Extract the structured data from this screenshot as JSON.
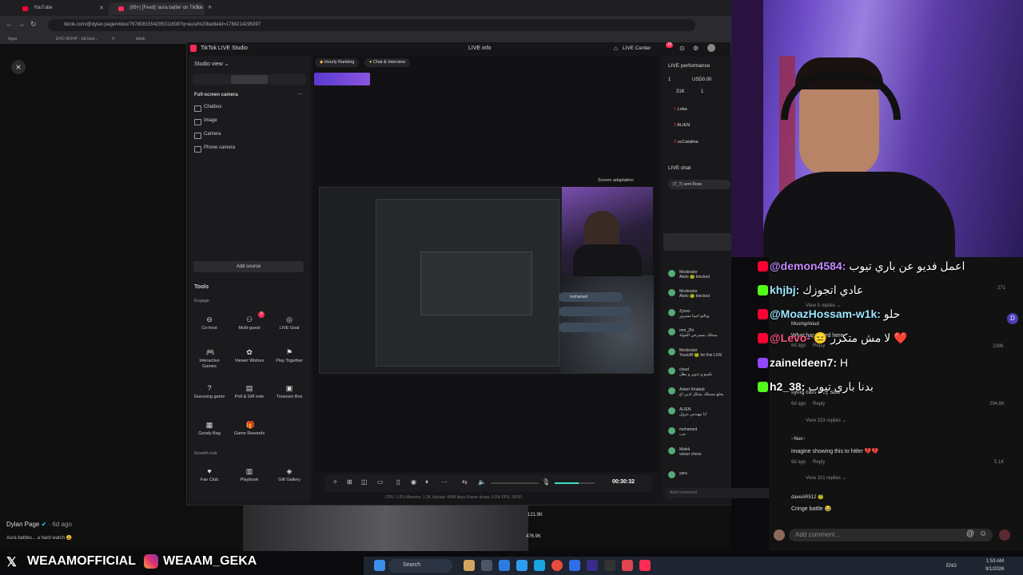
{
  "browser": {
    "tabs": [
      {
        "title": "YouTube",
        "color": "#ff0033"
      },
      {
        "title": "(99+) [Feed] 'aura battle' on TikTok",
        "color": "#fe2c55"
      }
    ],
    "new_tab": "+",
    "url": "tiktok.com/@dylan.page/video/7678081554295311638?q=aura%20battle&t=1788214295397",
    "bookmarks": [
      "Apps",
      "EHC-MOHP - EESeid...",
      "X",
      "tiktok"
    ]
  },
  "close_label": "×",
  "studio": {
    "title": "TikTok LIVE Studio",
    "live_info": "LIVE info",
    "live_center": "LIVE Center",
    "badge_count": "10",
    "studio_view": "Studio view ⌄",
    "fullscreen_camera": "Full-screen camera",
    "sources": [
      "Chatbox",
      "Image",
      "Camera",
      "Phone camera"
    ],
    "add_source": "Add source",
    "tools_title": "Tools",
    "engage": "Engage",
    "tools": [
      {
        "label": "Co-host",
        "icon": "⊖"
      },
      {
        "label": "Multi-guest",
        "icon": "⚇",
        "badge": "3"
      },
      {
        "label": "LIVE Goal",
        "icon": "◎"
      },
      {
        "label": "Interactive Games",
        "icon": "🎮"
      },
      {
        "label": "Viewer Wishes",
        "icon": "✿"
      },
      {
        "label": "Play Together",
        "icon": "⚑"
      },
      {
        "label": "Guessing game",
        "icon": "?"
      },
      {
        "label": "Poll & Gift vote",
        "icon": "▤"
      },
      {
        "label": "Treasure Box",
        "icon": "▣"
      },
      {
        "label": "Goody Bag",
        "icon": "▦"
      },
      {
        "label": "Game Rewards",
        "icon": "🎁"
      }
    ],
    "growth_hub": "Growth hub",
    "growth_tools": [
      {
        "label": "Fan Club",
        "icon": "♥"
      },
      {
        "label": "Playbook",
        "icon": "▥"
      },
      {
        "label": "Gift Gallery",
        "icon": "◈"
      }
    ],
    "pills": [
      "Hourly Ranking",
      "Chat & Interview"
    ],
    "screen_adaptation": "Screen adaptation",
    "timer": "00:30:32",
    "stats": "CPU: 1.6%   Memory: 1.2K   Upload: 4584 kbps   Frame drops: 0.0%   FPS: 30/30",
    "live_performance": "LIVE performance",
    "perf_values": {
      "viewers": "1",
      "usd": "USD0.00",
      "likes": "31K",
      "shares": "1"
    },
    "ranking": [
      "Loka",
      "ALIEN",
      "ucCatalina"
    ],
    "live_chat": "LIVE chat",
    "sent_rose": "(T_T) sent Rose",
    "chat": [
      {
        "user": "cloud",
        "text": "نكسو و تدوير و بطل"
      },
      {
        "user": "Moderator",
        "text": "Abdo 🐸 blocked"
      },
      {
        "user": "Moderator",
        "text": "Abdo 🐸 blocked"
      },
      {
        "user": "Zynex",
        "text": "وبالتو اجينا مسرور"
      },
      {
        "user": "mm_Zhi",
        "text": "ممثلك بمسرحي الجولة"
      },
      {
        "user": "Moderator",
        "text": "YoutuBf 🐸 for this LIVE"
      },
      {
        "user": "cloud",
        "text": "نكسو و تدوير و بطل"
      },
      {
        "user": "Adam Khattab",
        "text": "يخلع مستلك بشكل لدين اخ"
      },
      {
        "user": "ALIEN",
        "text": "انا مهندس بترول"
      },
      {
        "user": "mohamed",
        "text": "حب"
      },
      {
        "user": "Malek",
        "text": "voiser chera"
      },
      {
        "user": "yara",
        "text": "joined"
      }
    ],
    "add_comment": "Add comment"
  },
  "overlay_chat": [
    {
      "platform": "youtube",
      "name": "@demon4584:",
      "text": "اعمل فديو عن باري تيوب",
      "color": "#c48cff"
    },
    {
      "platform": "kick",
      "name": "khjbj:",
      "text": "عادي اتجوزك",
      "color": "#53fc18"
    },
    {
      "platform": "youtube",
      "name": "@MoazHossam-w1k:",
      "text": "حلو",
      "color": "#9fe8ff"
    },
    {
      "platform": "youtube",
      "name": "@Levo-",
      "text": "😑 لا مش متكرر ❤️",
      "color": "#ff5b8a"
    },
    {
      "platform": "twitch",
      "name": "zaineldeen7:",
      "text": "H",
      "color": "#ffffff"
    },
    {
      "platform": "kick",
      "name": "h2_38:",
      "text": "بدنا باري تيوب",
      "color": "#ffffff"
    }
  ],
  "tiktok_side": {
    "view_replies_5": "View 5 replies ⌄",
    "musing": "MusingAloud",
    "what_happ": "What happened here",
    "reply": "Reply",
    "flying": "flying cars they said",
    "view_153": "View 153 replies ⌄",
    "nux": "~Nux~",
    "hitler": "imagine showing this to hitler 💔💔",
    "view_101": "View 101 replies ⌄",
    "dave": "daveAR512 🐸",
    "cringe": "Cringe battle 😂",
    "times": [
      "6d ago",
      "6d ago",
      "6d ago",
      "6d ago"
    ],
    "likes": [
      "271",
      "2396",
      "294.8K",
      "5.1K"
    ],
    "comment_placeholder": "Add comment..."
  },
  "video_info": {
    "author": "Dylan Page",
    "time": "· 6d ago",
    "caption": "Aura battles... a hard watch 😩",
    "likes": "121.9K",
    "shares": "476.9K"
  },
  "social": {
    "x_handle": "WEAAMOFFICIAL",
    "ig_handle": "WEAAM_GEKA"
  },
  "taskbar": {
    "search": "Search",
    "lang": "ENG",
    "time": "1:53 AM",
    "date": "9/1/2026"
  },
  "colors": {
    "tiktok": "#fe2c55",
    "youtube": "#ff0033",
    "kick": "#53fc18",
    "twitch": "#9146ff"
  }
}
